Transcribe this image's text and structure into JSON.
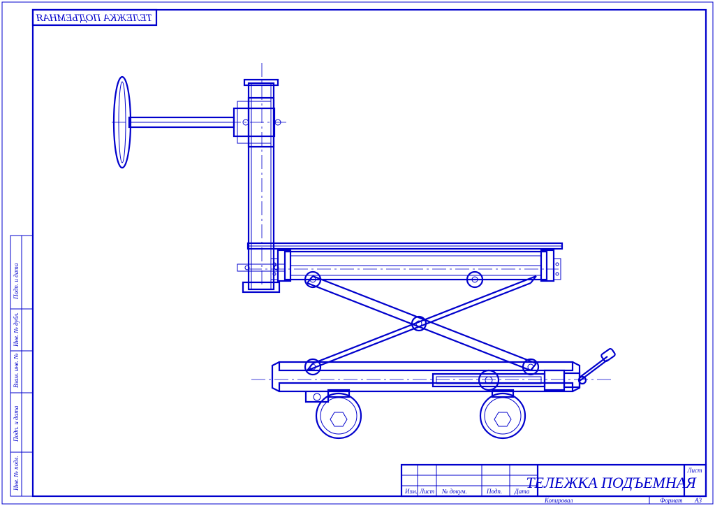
{
  "drawing": {
    "title": "ТЕЛЕЖКА ПОДЪЕМНАЯ",
    "title_mirror": "ТЕЛЕЖКА ПОДЪЕМНАЯ",
    "format_label": "Формат",
    "format_value": "А3",
    "copy_label": "Копировал",
    "sheet_label": "Лист",
    "tb": {
      "izm": "Изм.",
      "list": "Лист",
      "ndokum": "№ докум.",
      "podp": "Подп.",
      "data": "Дата"
    },
    "side_labels": {
      "inv_n_podl": "Инв. № подл.",
      "podp_data1": "Подп. и дата",
      "vzam_inv": "Взам. инв. №",
      "inv_n_dubl": "Инв. № дубл.",
      "podp_data2": "Подп. и дата"
    }
  }
}
